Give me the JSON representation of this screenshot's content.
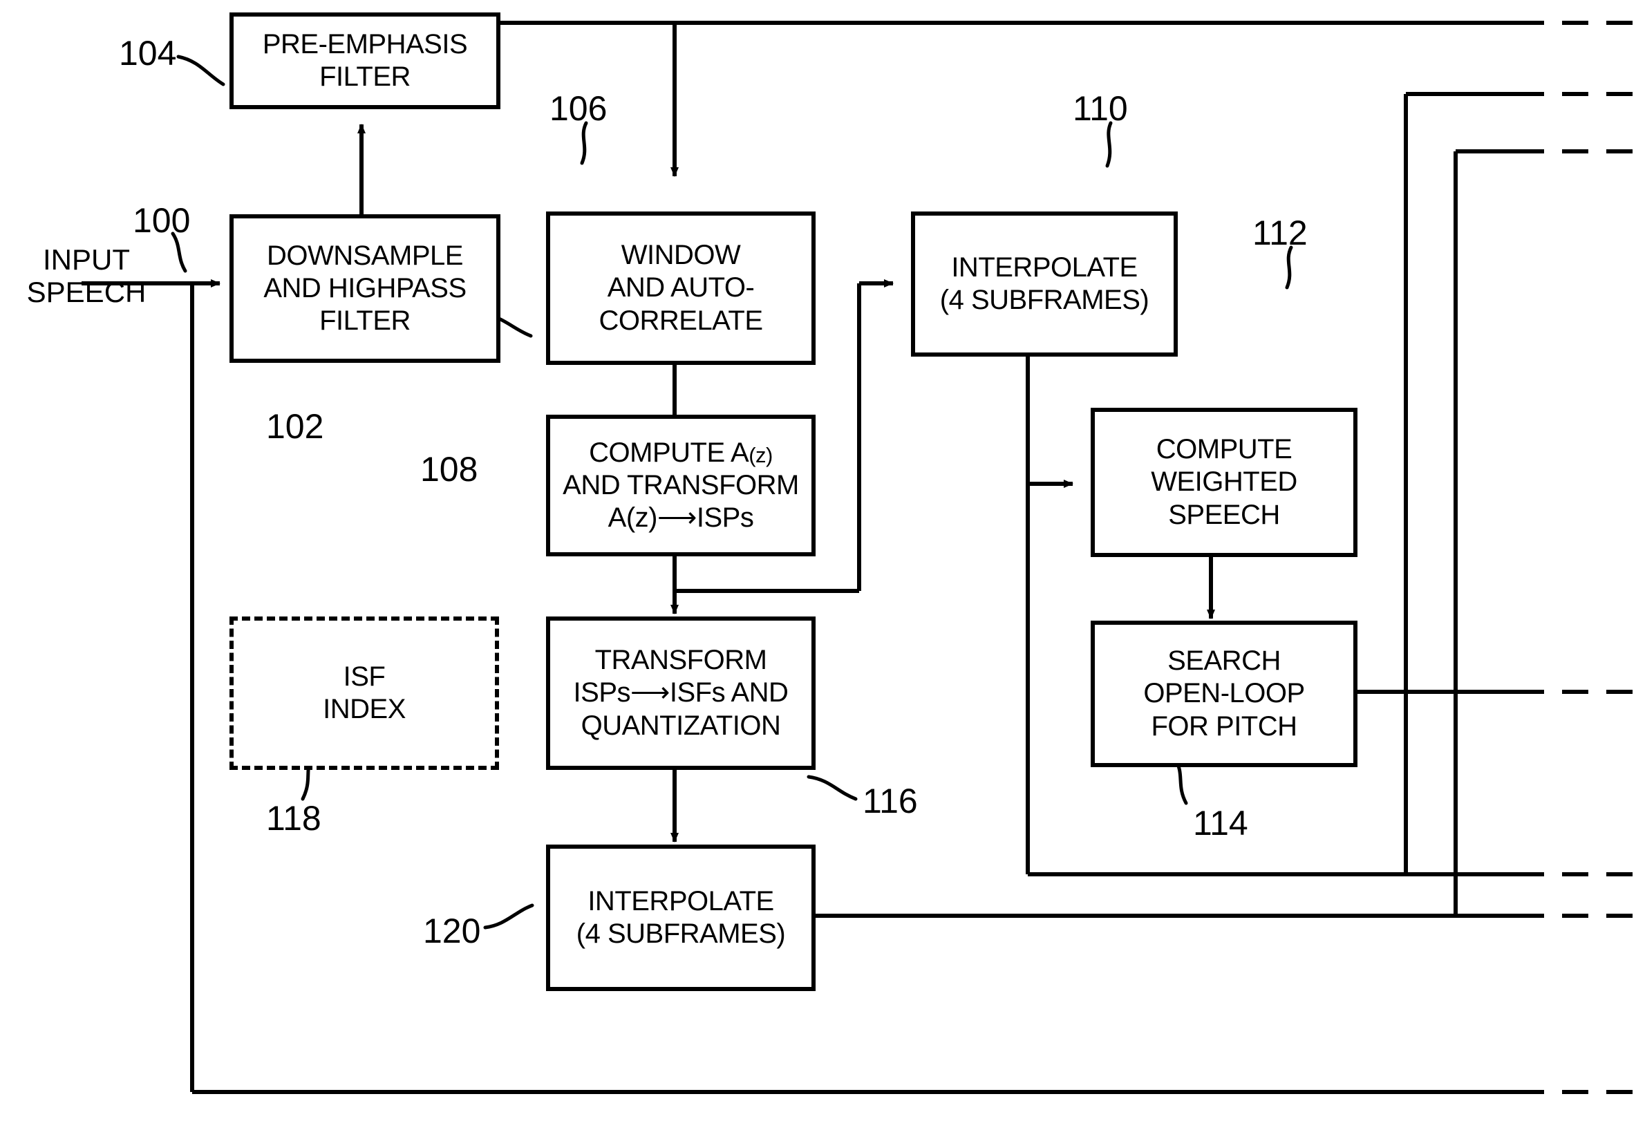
{
  "figure": {
    "type": "patent-block-diagram",
    "title": "Speech encoder pre-processing and LP analysis block diagram"
  },
  "signals": {
    "input_speech_line1": "INPUT",
    "input_speech_line2": "SPEECH"
  },
  "blocks": [
    {
      "id": "pre-emphasis-filter",
      "ref": "104",
      "lines": [
        "PRE-EMPHASIS",
        "FILTER"
      ],
      "dashed": false
    },
    {
      "id": "downsample-and-highpass-filter",
      "ref": "102",
      "lines": [
        "DOWNSAMPLE",
        "AND HIGHPASS",
        "FILTER"
      ],
      "dashed": false
    },
    {
      "id": "window-and-autocorrelate",
      "ref": "106",
      "lines": [
        "WINDOW",
        "AND AUTO-",
        "CORRELATE"
      ],
      "dashed": false
    },
    {
      "id": "compute-az-and-transform",
      "ref": "108",
      "lines": [
        "COMPUTE A(z)",
        "AND TRANSFORM",
        "A(z) → ISPs"
      ],
      "dashed": false
    },
    {
      "id": "interpolate-4-subframes-upper",
      "ref": "110",
      "lines": [
        "INTERPOLATE",
        "(4 SUBFRAMES)"
      ],
      "dashed": false
    },
    {
      "id": "compute-weighted-speech",
      "ref": "112",
      "lines": [
        "COMPUTE",
        "WEIGHTED",
        "SPEECH"
      ],
      "dashed": false
    },
    {
      "id": "search-open-loop-for-pitch",
      "ref": "114",
      "lines": [
        "SEARCH",
        "OPEN-LOOP",
        "FOR PITCH"
      ],
      "dashed": false
    },
    {
      "id": "transform-isps-isfs-and-quantization",
      "ref": "116",
      "lines": [
        "TRANSFORM",
        "ISPs → ISFs AND",
        "QUANTIZATION"
      ],
      "dashed": false
    },
    {
      "id": "isf-index",
      "ref": "118",
      "lines": [
        "ISF",
        "INDEX"
      ],
      "dashed": true
    },
    {
      "id": "interpolate-4-subframes-lower",
      "ref": "120",
      "lines": [
        "INTERPOLATE",
        "(4 SUBFRAMES)"
      ],
      "dashed": false
    }
  ],
  "reference_numerals": {
    "input_speech_leader": "100",
    "downsample": "102",
    "pre_emphasis": "104",
    "window": "106",
    "compute_az": "108",
    "interpolate_upper": "110",
    "compute_weighted": "112",
    "search_open_loop": "114",
    "transform_isps": "116",
    "isf_index": "118",
    "interpolate_lower": "120"
  },
  "block_text": {
    "pre_emphasis_l1": "PRE-EMPHASIS",
    "pre_emphasis_l2": "FILTER",
    "downsample_l1": "DOWNSAMPLE",
    "downsample_l2": "AND HIGHPASS",
    "downsample_l3": "FILTER",
    "window_l1": "WINDOW",
    "window_l2": "AND AUTO-",
    "window_l3": "CORRELATE",
    "compute_az_l1a": "COMPUTE A",
    "compute_az_l1b": "(z)",
    "compute_az_l2": "AND TRANSFORM",
    "compute_az_l3a": "A(z)",
    "compute_az_l3arrow": "⟶",
    "compute_az_l3b": "ISPs",
    "interp_up_l1": "INTERPOLATE",
    "interp_up_l2": "(4 SUBFRAMES)",
    "weighted_l1": "COMPUTE",
    "weighted_l2": "WEIGHTED",
    "weighted_l3": "SPEECH",
    "pitch_l1": "SEARCH",
    "pitch_l2": "OPEN-LOOP",
    "pitch_l3": "FOR PITCH",
    "transform_l1": "TRANSFORM",
    "transform_l2a": "ISPs",
    "transform_l2arrow": "⟶",
    "transform_l2b": "ISFs AND",
    "transform_l3": "QUANTIZATION",
    "isf_l1": "ISF",
    "isf_l2": "INDEX",
    "interp_lo_l1": "INTERPOLATE",
    "interp_lo_l2": "(4 SUBFRAMES)"
  },
  "colors": {
    "stroke": "#000000",
    "background": "#ffffff"
  }
}
